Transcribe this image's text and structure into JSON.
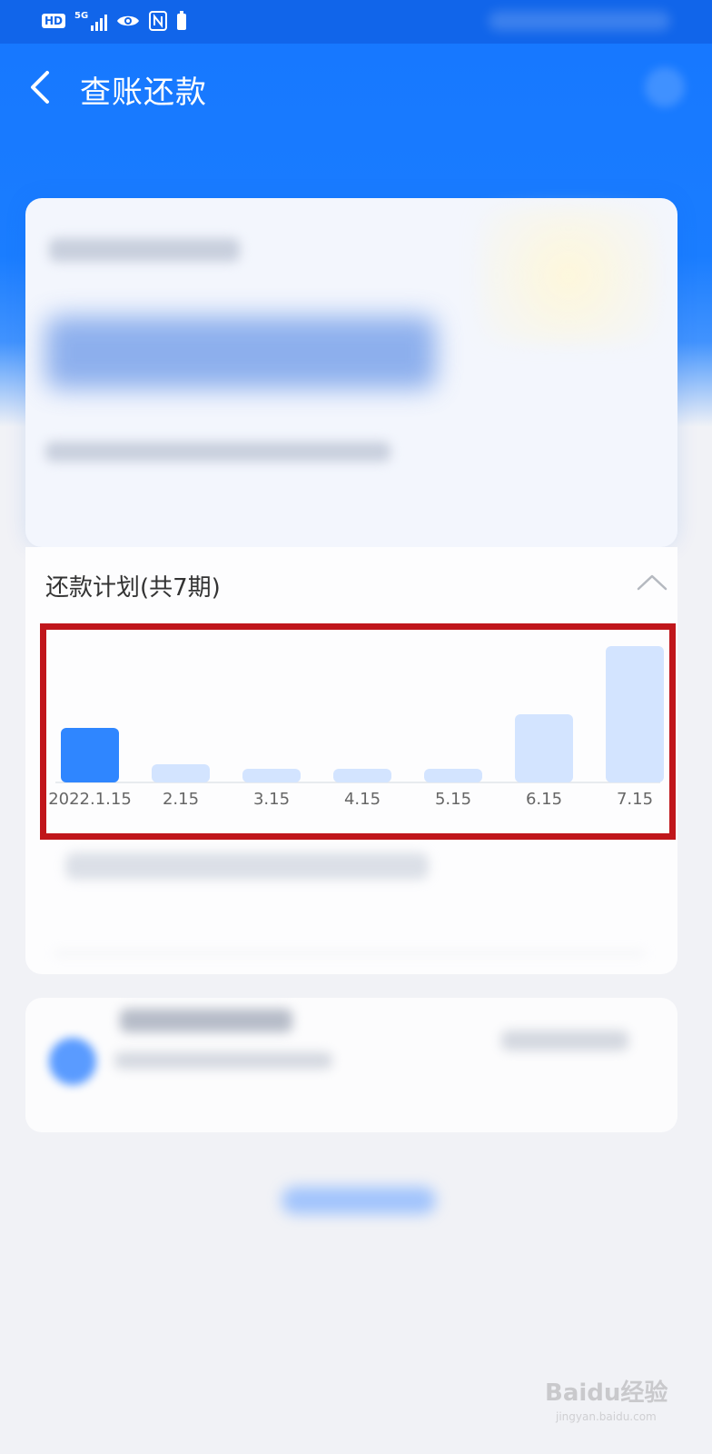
{
  "status_bar": {
    "hd_label": "HD",
    "network_label": "5G",
    "icons": [
      "signal-icon",
      "eye-icon",
      "nfc-icon",
      "battery-icon"
    ]
  },
  "header": {
    "title": "查账还款"
  },
  "plan": {
    "title": "还款计划(共7期)"
  },
  "chart_data": {
    "type": "bar",
    "categories": [
      "2022.1.15",
      "2.15",
      "3.15",
      "4.15",
      "5.15",
      "6.15",
      "7.15"
    ],
    "values": [
      60,
      20,
      15,
      15,
      15,
      75,
      150
    ],
    "highlighted_index": 0,
    "colors": {
      "highlight": "#2f86ff",
      "normal": "#d3e4ff",
      "axis": "#e2e5ea"
    }
  },
  "watermark": {
    "brand": "Baidu经验",
    "url": "jingyan.baidu.com"
  }
}
